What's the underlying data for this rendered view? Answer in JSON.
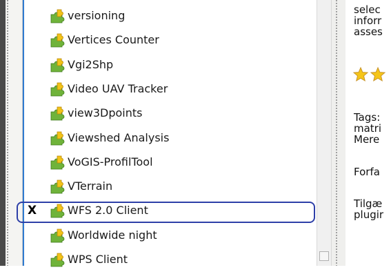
{
  "plugins": [
    {
      "name": "versioning",
      "checked": false
    },
    {
      "name": "Vertices Counter",
      "checked": false
    },
    {
      "name": "Vgi2Shp",
      "checked": false
    },
    {
      "name": "Video UAV Tracker",
      "checked": false
    },
    {
      "name": "view3Dpoints",
      "checked": false
    },
    {
      "name": "Viewshed Analysis",
      "checked": false
    },
    {
      "name": "VoGIS-ProfilTool",
      "checked": false
    },
    {
      "name": "VTerrain",
      "checked": false
    },
    {
      "name": "WFS 2.0 Client",
      "checked": true,
      "check_mark": "X"
    },
    {
      "name": "Worldwide night",
      "checked": false
    },
    {
      "name": "WPS Client",
      "checked": false
    }
  ],
  "icon": "puzzle-piece-icon",
  "colors": {
    "puzzle_green": "#6fb33a",
    "puzzle_yellow": "#f2c318",
    "highlight_border": "#2d3fa8",
    "list_border": "#2f7bd0",
    "star": "#f5c518"
  },
  "detail": {
    "line1": "selec",
    "line2": "inforr",
    "line3": "asses",
    "tags_label": "Tags:",
    "tags_value": "matri",
    "more": "Mere",
    "author_label": "Forfa",
    "available_label": "Tilgæ",
    "available_value": "plugir"
  }
}
